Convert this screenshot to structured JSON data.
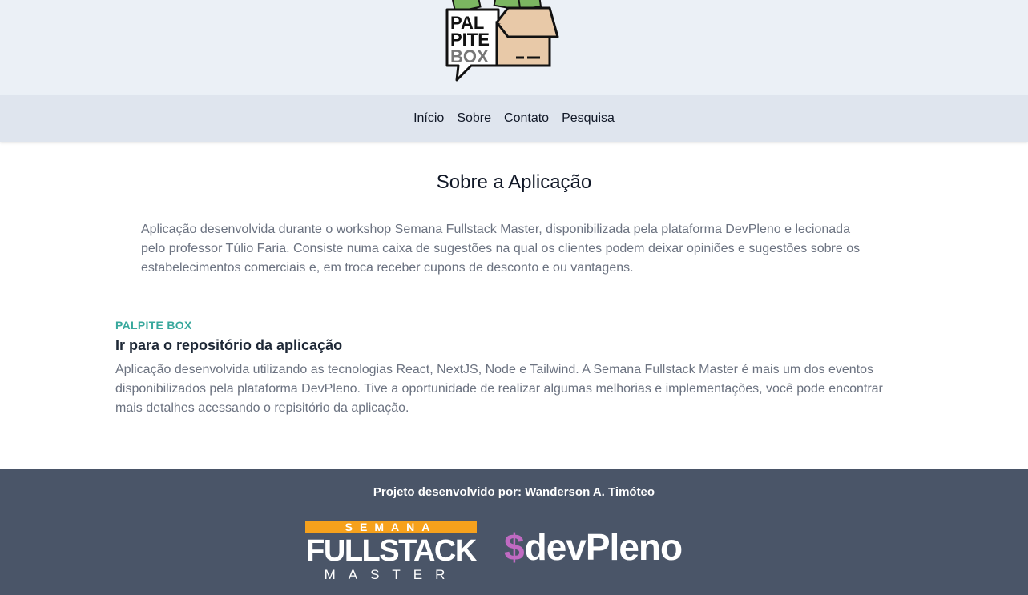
{
  "brand": {
    "logo_line1": "PAL",
    "logo_line2": "PITE",
    "logo_line3": "BOX"
  },
  "nav": {
    "items": [
      {
        "label": "Início"
      },
      {
        "label": "Sobre"
      },
      {
        "label": "Contato"
      },
      {
        "label": "Pesquisa"
      }
    ]
  },
  "main": {
    "title": "Sobre a Aplicação",
    "intro": "Aplicação desenvolvida durante o workshop Semana Fullstack Master, disponibilizada pela plataforma DevPleno e lecionada pelo professor Túlio Faria. Consiste numa caixa de sugestões na qual os clientes podem deixar opiniões e sugestões sobre os estabelecimentos comerciais e, em troca receber cupons de desconto e ou vantagens.",
    "eyebrow": "PALPITE BOX",
    "repo_link": "Ir para o repositório da aplicação",
    "description": "Aplicação desenvolvida utilizando as tecnologias React, NextJS, Node e Tailwind. A Semana Fullstack Master é mais um dos eventos disponibilizados pela plataforma DevPleno. Tive a oportunidade de realizar algumas melhorias e implementações, você pode encontrar mais detalhes acessando o repisitório da aplicação."
  },
  "footer": {
    "credit": "Projeto desenvolvido por: Wanderson A. Timóteo",
    "sfm_semana": "SEMANA",
    "sfm_full": "FULLSTACK",
    "sfm_master": "MASTER",
    "devpleno_dollar": "$",
    "devpleno_word": "devPleno"
  },
  "colors": {
    "header_bg": "#ebf0f6",
    "nav_bg": "#dfe5ee",
    "footer_bg": "#4a5568",
    "accent_teal": "#38a89d",
    "sfm_orange": "#f6a11c",
    "devpleno_pink": "#c06ac2",
    "box_tan": "#e8c9a8",
    "money_green": "#7bb661"
  }
}
